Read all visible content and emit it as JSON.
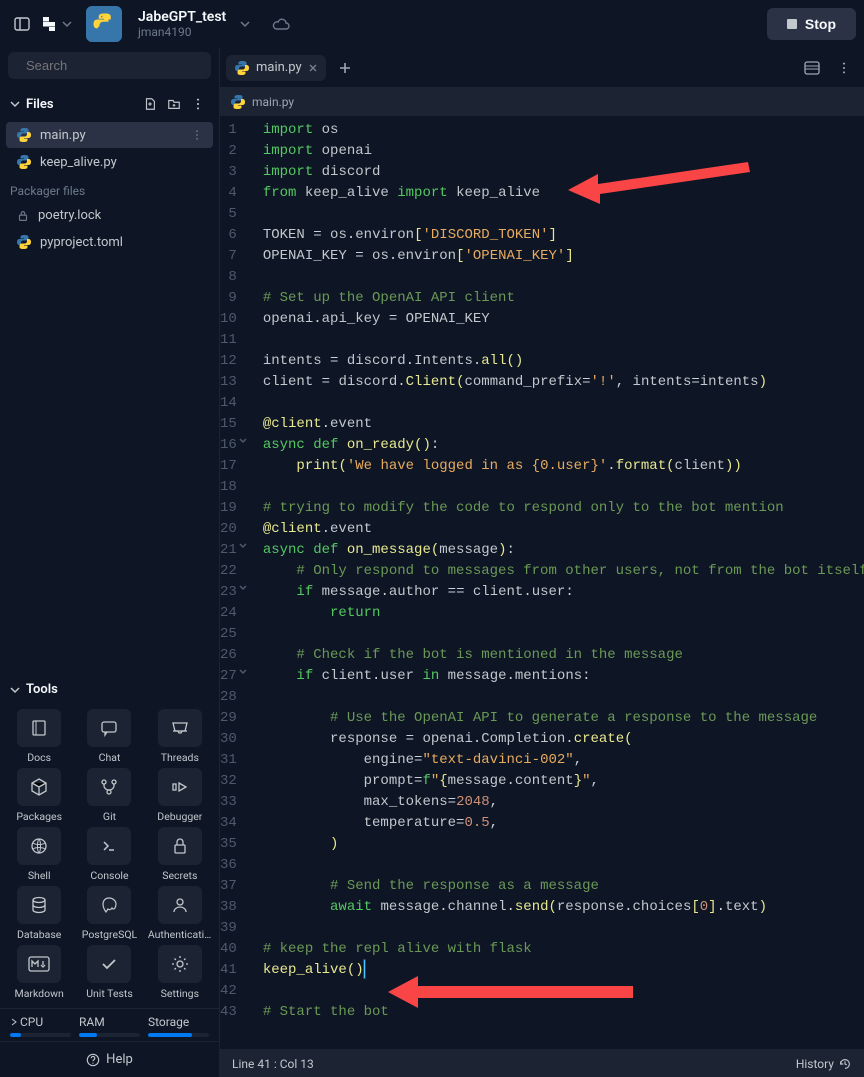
{
  "header": {
    "project_title": "JabeGPT_test",
    "project_owner": "jman4190",
    "stop_label": "Stop"
  },
  "sidebar": {
    "search_placeholder": "Search",
    "files_label": "Files",
    "files": [
      {
        "name": "main.py",
        "active": true
      },
      {
        "name": "keep_alive.py",
        "active": false
      }
    ],
    "packager_label": "Packager files",
    "packager_files": [
      {
        "name": "poetry.lock"
      },
      {
        "name": "pyproject.toml"
      }
    ],
    "tools_label": "Tools",
    "tools": [
      "Docs",
      "Chat",
      "Threads",
      "Packages",
      "Git",
      "Debugger",
      "Shell",
      "Console",
      "Secrets",
      "Database",
      "PostgreSQL",
      "Authenticati...",
      "Markdown",
      "Unit Tests",
      "Settings"
    ],
    "resources": {
      "cpu": {
        "label": "CPU",
        "pct": 18
      },
      "ram": {
        "label": "RAM",
        "pct": 30
      },
      "storage": {
        "label": "Storage",
        "pct": 72
      }
    },
    "help_label": "Help"
  },
  "editor": {
    "tab_label": "main.py",
    "breadcrumb": "main.py",
    "status_pos": "Line 41 : Col 13",
    "history_label": "History",
    "code_lines": [
      [
        {
          "c": "kw",
          "t": "import"
        },
        {
          "c": "op",
          "t": " os"
        }
      ],
      [
        {
          "c": "kw",
          "t": "import"
        },
        {
          "c": "op",
          "t": " openai"
        }
      ],
      [
        {
          "c": "kw",
          "t": "import"
        },
        {
          "c": "op",
          "t": " discord"
        }
      ],
      [
        {
          "c": "kw",
          "t": "from"
        },
        {
          "c": "op",
          "t": " keep_alive "
        },
        {
          "c": "kw",
          "t": "import"
        },
        {
          "c": "op",
          "t": " keep_alive"
        }
      ],
      [],
      [
        {
          "c": "op",
          "t": "TOKEN "
        },
        {
          "c": "pun",
          "t": "= "
        },
        {
          "c": "op",
          "t": "os"
        },
        {
          "c": "pun",
          "t": "."
        },
        {
          "c": "op",
          "t": "environ"
        },
        {
          "c": "strbr",
          "t": "["
        },
        {
          "c": "str",
          "t": "'DISCORD_TOKEN'"
        },
        {
          "c": "strbr",
          "t": "]"
        }
      ],
      [
        {
          "c": "op",
          "t": "OPENAI_KEY "
        },
        {
          "c": "pun",
          "t": "= "
        },
        {
          "c": "op",
          "t": "os"
        },
        {
          "c": "pun",
          "t": "."
        },
        {
          "c": "op",
          "t": "environ"
        },
        {
          "c": "strbr",
          "t": "["
        },
        {
          "c": "str",
          "t": "'OPENAI_KEY'"
        },
        {
          "c": "strbr",
          "t": "]"
        }
      ],
      [],
      [
        {
          "c": "cmt",
          "t": "# Set up the OpenAI API client"
        }
      ],
      [
        {
          "c": "op",
          "t": "openai"
        },
        {
          "c": "pun",
          "t": "."
        },
        {
          "c": "op",
          "t": "api_key "
        },
        {
          "c": "pun",
          "t": "= "
        },
        {
          "c": "op",
          "t": "OPENAI_KEY"
        }
      ],
      [],
      [
        {
          "c": "op",
          "t": "intents "
        },
        {
          "c": "pun",
          "t": "= "
        },
        {
          "c": "op",
          "t": "discord"
        },
        {
          "c": "pun",
          "t": "."
        },
        {
          "c": "op",
          "t": "Intents"
        },
        {
          "c": "pun",
          "t": "."
        },
        {
          "c": "fn",
          "t": "all"
        },
        {
          "c": "strbr",
          "t": "()"
        }
      ],
      [
        {
          "c": "op",
          "t": "client "
        },
        {
          "c": "pun",
          "t": "= "
        },
        {
          "c": "op",
          "t": "discord"
        },
        {
          "c": "pun",
          "t": "."
        },
        {
          "c": "fn",
          "t": "Client"
        },
        {
          "c": "strbr",
          "t": "("
        },
        {
          "c": "op",
          "t": "command_prefix"
        },
        {
          "c": "pun",
          "t": "="
        },
        {
          "c": "str",
          "t": "'!'"
        },
        {
          "c": "pun",
          "t": ", "
        },
        {
          "c": "op",
          "t": "intents"
        },
        {
          "c": "pun",
          "t": "="
        },
        {
          "c": "op",
          "t": "intents"
        },
        {
          "c": "strbr",
          "t": ")"
        }
      ],
      [],
      [
        {
          "c": "fn",
          "t": "@client"
        },
        {
          "c": "pun",
          "t": "."
        },
        {
          "c": "op",
          "t": "event"
        }
      ],
      [
        {
          "c": "kw",
          "t": "async def "
        },
        {
          "c": "fn",
          "t": "on_ready"
        },
        {
          "c": "strbr",
          "t": "()"
        },
        {
          "c": "pun",
          "t": ":"
        }
      ],
      [
        {
          "c": "op",
          "t": "    "
        },
        {
          "c": "fn",
          "t": "print"
        },
        {
          "c": "strbr",
          "t": "("
        },
        {
          "c": "str",
          "t": "'We have logged in as {0.user}'"
        },
        {
          "c": "pun",
          "t": "."
        },
        {
          "c": "fn",
          "t": "format"
        },
        {
          "c": "strbr",
          "t": "("
        },
        {
          "c": "op",
          "t": "client"
        },
        {
          "c": "strbr",
          "t": "))"
        }
      ],
      [],
      [
        {
          "c": "cmt",
          "t": "# trying to modify the code to respond only to the bot mention"
        }
      ],
      [
        {
          "c": "fn",
          "t": "@client"
        },
        {
          "c": "pun",
          "t": "."
        },
        {
          "c": "op",
          "t": "event"
        }
      ],
      [
        {
          "c": "kw",
          "t": "async def "
        },
        {
          "c": "fn",
          "t": "on_message"
        },
        {
          "c": "strbr",
          "t": "("
        },
        {
          "c": "op",
          "t": "message"
        },
        {
          "c": "strbr",
          "t": ")"
        },
        {
          "c": "pun",
          "t": ":"
        }
      ],
      [
        {
          "c": "op",
          "t": "    "
        },
        {
          "c": "cmt",
          "t": "# Only respond to messages from other users, not from the bot itself"
        }
      ],
      [
        {
          "c": "op",
          "t": "    "
        },
        {
          "c": "kw",
          "t": "if"
        },
        {
          "c": "op",
          "t": " message"
        },
        {
          "c": "pun",
          "t": "."
        },
        {
          "c": "op",
          "t": "author "
        },
        {
          "c": "pun",
          "t": "== "
        },
        {
          "c": "op",
          "t": "client"
        },
        {
          "c": "pun",
          "t": "."
        },
        {
          "c": "op",
          "t": "user"
        },
        {
          "c": "pun",
          "t": ":"
        }
      ],
      [
        {
          "c": "op",
          "t": "        "
        },
        {
          "c": "kw",
          "t": "return"
        }
      ],
      [],
      [
        {
          "c": "op",
          "t": "    "
        },
        {
          "c": "cmt",
          "t": "# Check if the bot is mentioned in the message"
        }
      ],
      [
        {
          "c": "op",
          "t": "    "
        },
        {
          "c": "kw",
          "t": "if"
        },
        {
          "c": "op",
          "t": " client"
        },
        {
          "c": "pun",
          "t": "."
        },
        {
          "c": "op",
          "t": "user "
        },
        {
          "c": "kw",
          "t": "in"
        },
        {
          "c": "op",
          "t": " message"
        },
        {
          "c": "pun",
          "t": "."
        },
        {
          "c": "op",
          "t": "mentions"
        },
        {
          "c": "pun",
          "t": ":"
        }
      ],
      [],
      [
        {
          "c": "op",
          "t": "        "
        },
        {
          "c": "cmt",
          "t": "# Use the OpenAI API to generate a response to the message"
        }
      ],
      [
        {
          "c": "op",
          "t": "        response "
        },
        {
          "c": "pun",
          "t": "= "
        },
        {
          "c": "op",
          "t": "openai"
        },
        {
          "c": "pun",
          "t": "."
        },
        {
          "c": "op",
          "t": "Completion"
        },
        {
          "c": "pun",
          "t": "."
        },
        {
          "c": "fn",
          "t": "create"
        },
        {
          "c": "strbr",
          "t": "("
        }
      ],
      [
        {
          "c": "op",
          "t": "            engine"
        },
        {
          "c": "pun",
          "t": "="
        },
        {
          "c": "str",
          "t": "\"text-davinci-002\""
        },
        {
          "c": "pun",
          "t": ","
        }
      ],
      [
        {
          "c": "op",
          "t": "            prompt"
        },
        {
          "c": "pun",
          "t": "="
        },
        {
          "c": "fstr",
          "t": "f"
        },
        {
          "c": "str",
          "t": "\""
        },
        {
          "c": "strbr",
          "t": "{"
        },
        {
          "c": "op",
          "t": "message"
        },
        {
          "c": "pun",
          "t": "."
        },
        {
          "c": "op",
          "t": "content"
        },
        {
          "c": "strbr",
          "t": "}"
        },
        {
          "c": "str",
          "t": "\""
        },
        {
          "c": "pun",
          "t": ","
        }
      ],
      [
        {
          "c": "op",
          "t": "            max_tokens"
        },
        {
          "c": "pun",
          "t": "="
        },
        {
          "c": "num",
          "t": "2048"
        },
        {
          "c": "pun",
          "t": ","
        }
      ],
      [
        {
          "c": "op",
          "t": "            temperature"
        },
        {
          "c": "pun",
          "t": "="
        },
        {
          "c": "num",
          "t": "0.5"
        },
        {
          "c": "pun",
          "t": ","
        }
      ],
      [
        {
          "c": "op",
          "t": "        "
        },
        {
          "c": "strbr",
          "t": ")"
        }
      ],
      [],
      [
        {
          "c": "op",
          "t": "        "
        },
        {
          "c": "cmt",
          "t": "# Send the response as a message"
        }
      ],
      [
        {
          "c": "op",
          "t": "        "
        },
        {
          "c": "kw",
          "t": "await"
        },
        {
          "c": "op",
          "t": " message"
        },
        {
          "c": "pun",
          "t": "."
        },
        {
          "c": "op",
          "t": "channel"
        },
        {
          "c": "pun",
          "t": "."
        },
        {
          "c": "fn",
          "t": "send"
        },
        {
          "c": "strbr",
          "t": "("
        },
        {
          "c": "op",
          "t": "response"
        },
        {
          "c": "pun",
          "t": "."
        },
        {
          "c": "op",
          "t": "choices"
        },
        {
          "c": "strbr",
          "t": "["
        },
        {
          "c": "num",
          "t": "0"
        },
        {
          "c": "strbr",
          "t": "]"
        },
        {
          "c": "pun",
          "t": "."
        },
        {
          "c": "op",
          "t": "text"
        },
        {
          "c": "strbr",
          "t": ")"
        }
      ],
      [],
      [
        {
          "c": "cmt",
          "t": "# keep the repl alive with flask"
        }
      ],
      [
        {
          "c": "fn",
          "t": "keep_alive"
        },
        {
          "c": "strbr",
          "t": "()"
        },
        {
          "c": "cursor",
          "t": ""
        }
      ],
      [],
      [
        {
          "c": "cmt",
          "t": "# Start the bot"
        }
      ]
    ],
    "fold_lines": [
      16,
      21,
      23,
      27
    ]
  },
  "annotations": {
    "arrows": [
      {
        "target_line": 4
      },
      {
        "target_line": 41
      }
    ]
  },
  "tool_icons": {
    "Docs": "book",
    "Chat": "chat",
    "Threads": "inbox",
    "Packages": "cube",
    "Git": "git",
    "Debugger": "play",
    "Shell": "shell",
    "Console": "console",
    "Secrets": "lock",
    "Database": "db",
    "PostgreSQL": "pg",
    "Authenticati...": "user",
    "Markdown": "md",
    "Unit Tests": "check",
    "Settings": "gear"
  }
}
